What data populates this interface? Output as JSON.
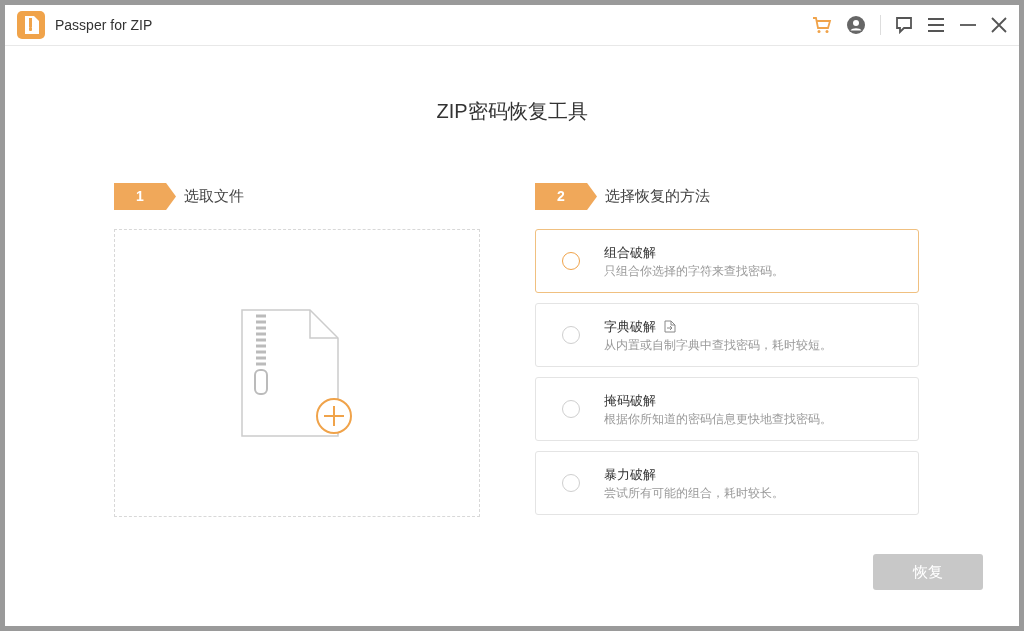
{
  "window": {
    "title": "Passper for ZIP"
  },
  "heading": "ZIP密码恢复工具",
  "steps": [
    {
      "number": "1",
      "label": "选取文件"
    },
    {
      "number": "2",
      "label": "选择恢复的方法"
    }
  ],
  "methods": [
    {
      "name": "组合破解",
      "description": "只组合你选择的字符来查找密码。",
      "selected": true,
      "has_file_icon": false
    },
    {
      "name": "字典破解",
      "description": "从内置或自制字典中查找密码，耗时较短。",
      "selected": false,
      "has_file_icon": true
    },
    {
      "name": "掩码破解",
      "description": "根据你所知道的密码信息更快地查找密码。",
      "selected": false,
      "has_file_icon": false
    },
    {
      "name": "暴力破解",
      "description": "尝试所有可能的组合，耗时较长。",
      "selected": false,
      "has_file_icon": false
    }
  ],
  "recover_button": {
    "label": "恢复",
    "disabled": true
  }
}
